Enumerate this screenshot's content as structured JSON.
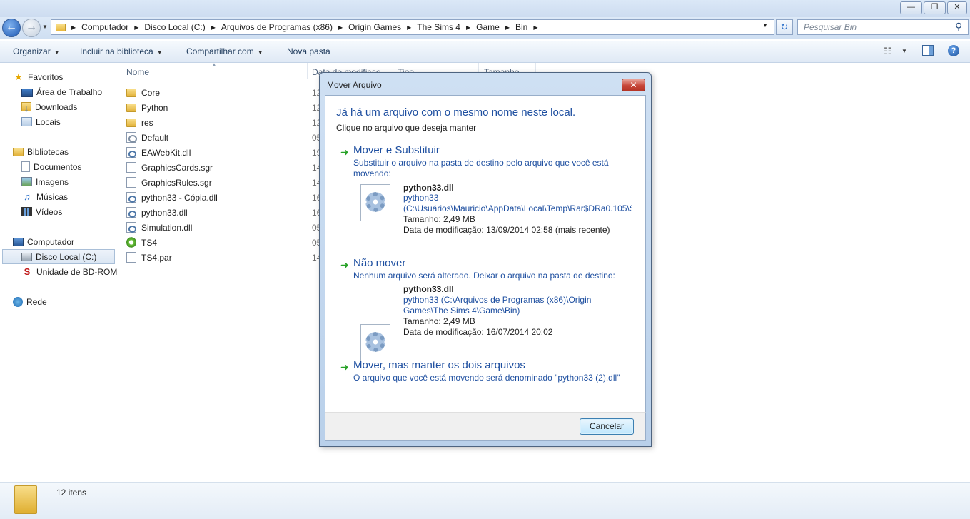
{
  "window": {
    "caption_buttons": [
      "minimize",
      "maximize",
      "close"
    ]
  },
  "address": {
    "crumbs": [
      "Computador",
      "Disco Local (C:)",
      "Arquivos de Programas (x86)",
      "Origin Games",
      "The Sims 4",
      "Game",
      "Bin"
    ],
    "search_placeholder": "Pesquisar Bin"
  },
  "toolbar": {
    "organize": "Organizar",
    "include_library": "Incluir na biblioteca",
    "share": "Compartilhar com",
    "new_folder": "Nova pasta"
  },
  "nav": {
    "favorites": "Favoritos",
    "desktop": "Área de Trabalho",
    "downloads": "Downloads",
    "places": "Locais",
    "libraries": "Bibliotecas",
    "documents": "Documentos",
    "images": "Imagens",
    "music": "Músicas",
    "videos": "Vídeos",
    "computer": "Computador",
    "local_disk": "Disco Local (C:)",
    "bd_rom": "Unidade de BD-ROM",
    "network": "Rede"
  },
  "columns": {
    "name": "Nome",
    "date": "Data de modificaç",
    "type": "Tipo",
    "size": "Tamanho"
  },
  "files": [
    {
      "name": "Core",
      "icon": "folder-icon",
      "date": "12"
    },
    {
      "name": "Python",
      "icon": "folder-icon",
      "date": "12"
    },
    {
      "name": "res",
      "icon": "folder-icon",
      "date": "12"
    },
    {
      "name": "Default",
      "icon": "config-file-icon",
      "date": "05"
    },
    {
      "name": "EAWebKit.dll",
      "icon": "dll-file-icon",
      "date": "19"
    },
    {
      "name": "GraphicsCards.sgr",
      "icon": "blank-file-icon",
      "date": "14"
    },
    {
      "name": "GraphicsRules.sgr",
      "icon": "blank-file-icon",
      "date": "14"
    },
    {
      "name": "python33 - Cópia.dll",
      "icon": "dll-file-icon",
      "date": "16"
    },
    {
      "name": "python33.dll",
      "icon": "dll-file-icon",
      "date": "16"
    },
    {
      "name": "Simulation.dll",
      "icon": "dll-file-icon",
      "date": "05"
    },
    {
      "name": "TS4",
      "icon": "ts4-app-icon",
      "date": "05"
    },
    {
      "name": "TS4.par",
      "icon": "blank-file-icon",
      "date": "14"
    }
  ],
  "status": {
    "item_count": "12 itens"
  },
  "dialog": {
    "title": "Mover Arquivo",
    "heading": "Já há um arquivo com o mesmo nome neste local.",
    "subheading": "Clique no arquivo que deseja manter",
    "option1": {
      "title": "Mover e Substituir",
      "desc": "Substituir o arquivo na pasta de destino pelo arquivo que você está movendo:",
      "file_name": "python33.dll",
      "file_line1": "python33",
      "file_line2": "(C:\\Usuários\\Mauricio\\AppData\\Local\\Temp\\Rar$DRa0.105\\S",
      "file_size": "Tamanho: 2,49 MB",
      "file_date": "Data de modificação: 13/09/2014 02:58 (mais recente)"
    },
    "option2": {
      "title": "Não mover",
      "desc": "Nenhum arquivo será alterado. Deixar o arquivo na pasta de destino:",
      "file_name": "python33.dll",
      "file_line1": "python33 (C:\\Arquivos de Programas (x86)\\Origin",
      "file_line2": "Games\\The Sims 4\\Game\\Bin)",
      "file_size": "Tamanho: 2,49 MB",
      "file_date": "Data de modificação: 16/07/2014 20:02"
    },
    "option3": {
      "title": "Mover, mas manter os dois arquivos",
      "desc": "O arquivo que você está movendo será denominado \"python33 (2).dll\""
    },
    "cancel": "Cancelar"
  }
}
